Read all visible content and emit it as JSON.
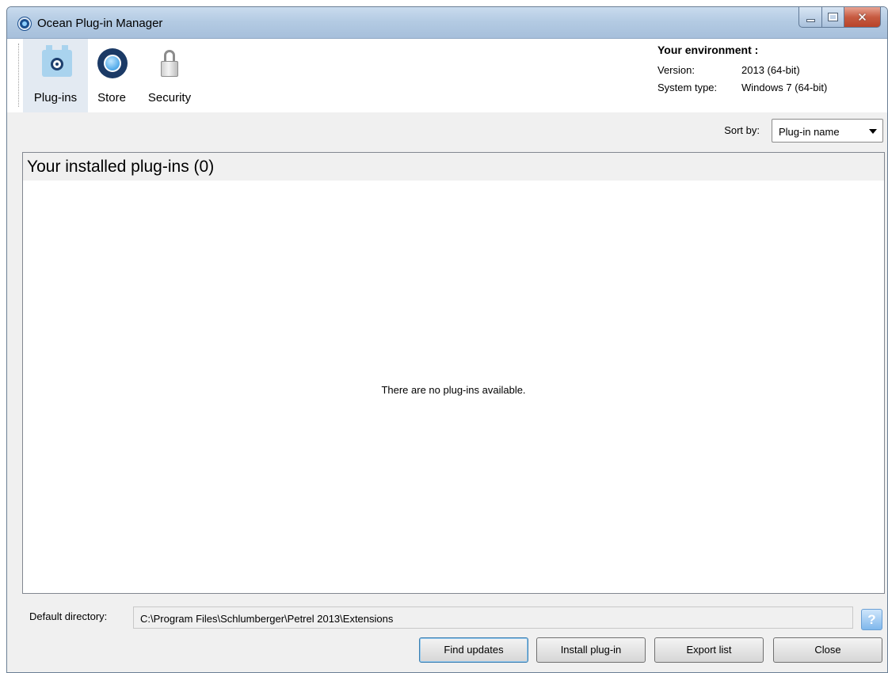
{
  "window": {
    "title": "Ocean Plug-in Manager"
  },
  "toolbar": {
    "items": [
      {
        "label": "Plug-ins",
        "icon": "plugin-icon",
        "selected": true
      },
      {
        "label": "Store",
        "icon": "store-icon",
        "selected": false
      },
      {
        "label": "Security",
        "icon": "lock-icon",
        "selected": false
      }
    ]
  },
  "environment": {
    "header": "Your environment :",
    "version_label": "Version:",
    "version_value": "2013 (64-bit)",
    "system_label": "System type:",
    "system_value": "Windows 7 (64-bit)"
  },
  "sort": {
    "label": "Sort by:",
    "selected": "Plug-in name"
  },
  "plugins": {
    "header": "Your installed plug-ins (0)",
    "empty_message": "There are no plug-ins available."
  },
  "directory": {
    "label": "Default directory:",
    "value": "C:\\Program Files\\Schlumberger\\Petrel 2013\\Extensions",
    "help_glyph": "?"
  },
  "buttons": {
    "find_updates": "Find updates",
    "install_plugin": "Install plug-in",
    "export_list": "Export list",
    "close": "Close"
  },
  "colors": {
    "titlebar": "#b4cbe3",
    "close_button": "#c75b41",
    "accent": "#1b3a66"
  }
}
